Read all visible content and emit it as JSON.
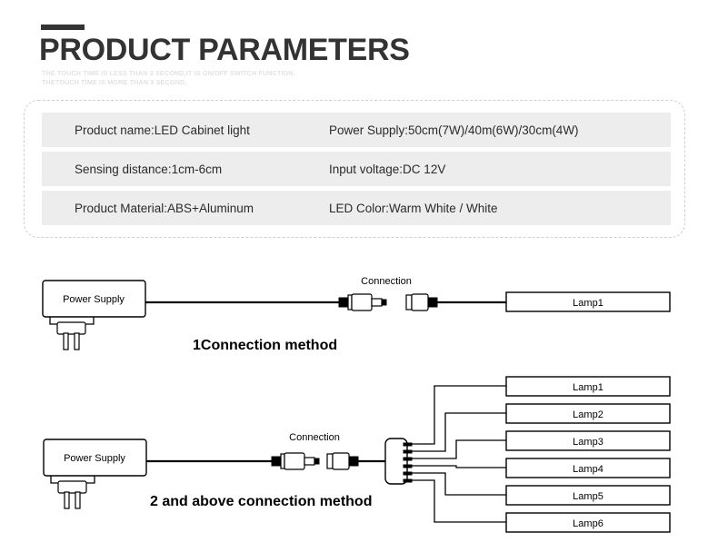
{
  "header": {
    "title": "PRODUCT PARAMETERS",
    "subtitle_line1": "THE TOUCH TIME IS LESS THAN 3 SECOND,IT IS ON/OFF SWITCH FUNCTION.",
    "subtitle_line2": "THETOUCH TIME IS MORE THAN 3 SECOND,",
    "accent_color": "#333333",
    "title_color": "#333333",
    "subtitle_color": "#e2e2e2"
  },
  "spec_table": {
    "panel_border_color": "#cfcfcf",
    "row_background": "#ededed",
    "rows": [
      {
        "left": "Product name:LED Cabinet light",
        "right": "Power Supply:50cm(7W)/40m(6W)/30cm(4W)"
      },
      {
        "left": "Sensing distance:1cm-6cm",
        "right": "Input voltage:DC 12V"
      },
      {
        "left": "Product Material:ABS+Aluminum",
        "right": "LED Color:Warm White / White"
      }
    ]
  },
  "diagram_1": {
    "caption": "1Connection method",
    "power_supply_label": "Power Supply",
    "connection_label": "Connection",
    "lamps": [
      "Lamp1"
    ]
  },
  "diagram_2": {
    "caption": "2 and above connection method",
    "power_supply_label": "Power Supply",
    "connection_label": "Connection",
    "splitter_ports": 6,
    "lamps": [
      "Lamp1",
      "Lamp2",
      "Lamp3",
      "Lamp4",
      "Lamp5",
      "Lamp6"
    ]
  }
}
